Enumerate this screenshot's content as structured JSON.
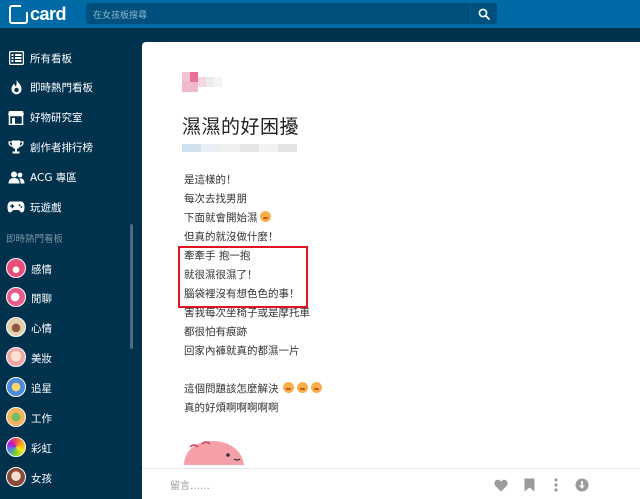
{
  "topbar": {
    "logo_text": "card",
    "search_placeholder": "在女孩板搜尋",
    "search_icon": "search-icon"
  },
  "sidebar": {
    "nav": [
      {
        "label": "所有看板",
        "icon": "list-icon"
      },
      {
        "label": "即時熱門看板",
        "icon": "flame-icon"
      },
      {
        "label": "好物研究室",
        "icon": "store-icon"
      },
      {
        "label": "創作者排行榜",
        "icon": "trophy-icon"
      },
      {
        "label": "ACG 專區",
        "icon": "users-icon"
      },
      {
        "label": "玩遊戲",
        "icon": "gamepad-icon"
      }
    ],
    "section_title": "即時熱門看板",
    "boards": [
      {
        "label": "感情",
        "color": "#e84e7a"
      },
      {
        "label": "閒聊",
        "color": "#e85c8c"
      },
      {
        "label": "心情",
        "color": "#c9a27a"
      },
      {
        "label": "美妝",
        "color": "#f2a6a6"
      },
      {
        "label": "追星",
        "color": "#4c8bd6"
      },
      {
        "label": "工作",
        "color": "#f0b45c"
      },
      {
        "label": "彩虹",
        "color": "#d46bd6"
      },
      {
        "label": "女孩",
        "color": "#d98a8a"
      }
    ]
  },
  "post": {
    "title": "濕濕的好困擾",
    "lines": [
      "是這樣的！",
      "每次去找男朋",
      "下面就會開始濕",
      "但真的就沒做什麼！",
      "牽牽手 抱一抱",
      "就很濕很濕了！",
      "腦袋裡沒有想色色的事！",
      "害我每次坐椅子或是摩托車",
      "都很怕有痕跡",
      "回家內褲就真的都濕一片",
      "",
      "這個問題該怎麼解決",
      "真的好煩啊啊啊啊啊"
    ]
  },
  "actionbar": {
    "comment_placeholder": "留言……",
    "icons": [
      "heart-icon",
      "bookmark-icon",
      "more-icon",
      "download-icon"
    ]
  },
  "colors": {
    "topbar": "#006aa6",
    "sidebar": "#00324e",
    "highlight_border": "#e0141e"
  }
}
